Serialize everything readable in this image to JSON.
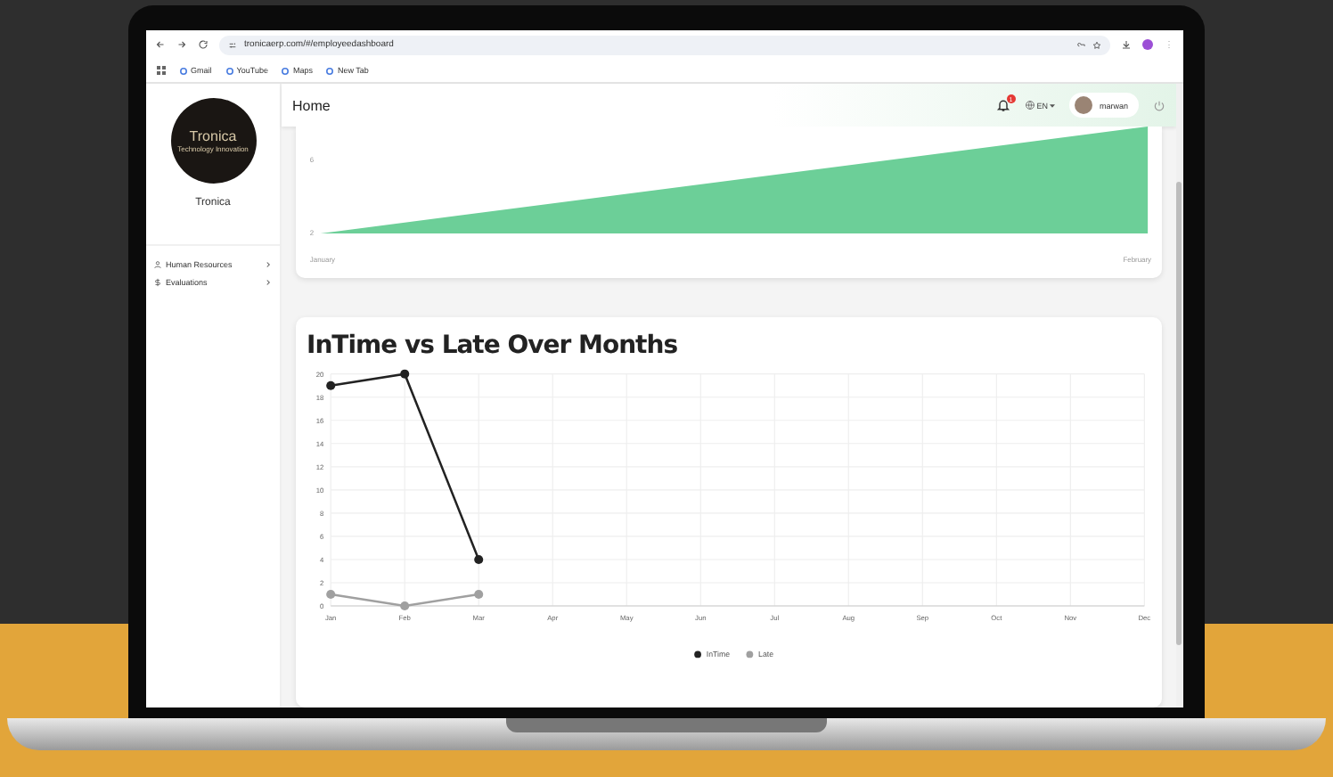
{
  "browser": {
    "url": "tronicaerp.com/#/employeedashboard",
    "bookmarks": [
      "Gmail",
      "YouTube",
      "Maps",
      "New Tab"
    ]
  },
  "sidebar": {
    "logo_text": "Tronica",
    "logo_tagline": "Technology Innovation",
    "company": "Tronica",
    "items": [
      {
        "label": "Human Resources",
        "expanded": false
      },
      {
        "label": "Evaluations",
        "expanded": false
      }
    ]
  },
  "header": {
    "title": "Home",
    "notifications": "1",
    "language": "EN",
    "user": "marwan"
  },
  "area_card": {
    "y_labels": [
      "6",
      "2"
    ],
    "x_labels": [
      "January",
      "February"
    ]
  },
  "line_card": {
    "title": "InTime vs Late Over Months",
    "chart_data": {
      "type": "line",
      "categories": [
        "Jan",
        "Feb",
        "Mar",
        "Apr",
        "May",
        "Jun",
        "Jul",
        "Aug",
        "Sep",
        "Oct",
        "Nov",
        "Dec"
      ],
      "ylim": [
        0,
        20
      ],
      "grid": true,
      "legend": true,
      "yticks": [
        0,
        2,
        4,
        6,
        8,
        10,
        12,
        14,
        16,
        18,
        20
      ],
      "series": [
        {
          "name": "InTime",
          "color": "#222222",
          "marker": "circle",
          "values": [
            19,
            20,
            4,
            null,
            null,
            null,
            null,
            null,
            null,
            null,
            null,
            null
          ]
        },
        {
          "name": "Late",
          "color": "#a0a0a0",
          "marker": "circle",
          "values": [
            1,
            0,
            1,
            null,
            null,
            null,
            null,
            null,
            null,
            null,
            null,
            null
          ]
        }
      ]
    }
  }
}
